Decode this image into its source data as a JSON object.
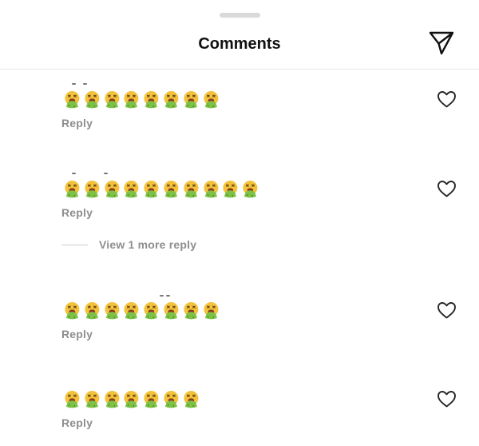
{
  "header": {
    "title": "Comments",
    "send_icon": "paper-plane-icon"
  },
  "comments": [
    {
      "emoji_count": 8,
      "emoji": "nauseated-vomiting-face",
      "reply_label": "Reply",
      "like_icon": "heart-outline-icon"
    },
    {
      "emoji_count": 10,
      "emoji": "nauseated-vomiting-face",
      "reply_label": "Reply",
      "like_icon": "heart-outline-icon",
      "view_more_label": "View 1 more reply"
    },
    {
      "emoji_count": 8,
      "emoji": "nauseated-vomiting-face",
      "reply_label": "Reply",
      "like_icon": "heart-outline-icon"
    },
    {
      "emoji_count": 7,
      "emoji": "nauseated-vomiting-face",
      "reply_label": "Reply",
      "like_icon": "heart-outline-icon"
    }
  ],
  "colors": {
    "text_primary": "#111111",
    "text_secondary": "#8e8e8e",
    "divider": "#e6e6e6",
    "emoji_face": "#f3c23b",
    "emoji_vomit": "#7dc246"
  }
}
